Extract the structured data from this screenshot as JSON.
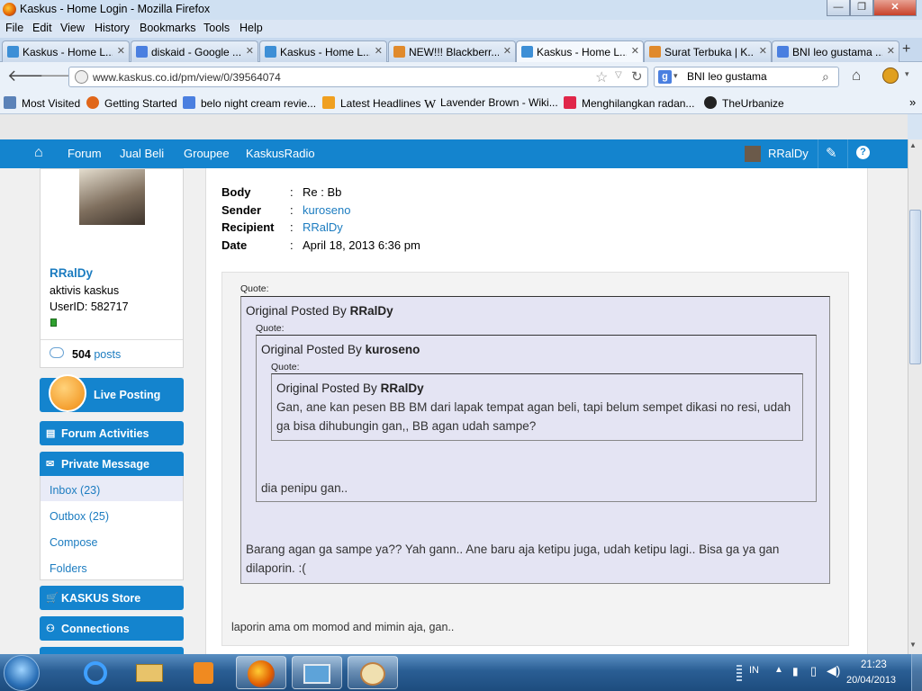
{
  "window": {
    "title": "Kaskus - Home Login - Mozilla Firefox",
    "min": "—",
    "max": "❐",
    "close": "✕"
  },
  "menu": [
    "File",
    "Edit",
    "View",
    "History",
    "Bookmarks",
    "Tools",
    "Help"
  ],
  "tabs": [
    {
      "label": "Kaskus - Home L...",
      "icon_color": "#3d8fd6"
    },
    {
      "label": "diskaid - Google ...",
      "icon_color": "#4a7fe0"
    },
    {
      "label": "Kaskus - Home L...",
      "icon_color": "#3d8fd6"
    },
    {
      "label": "NEW!!! Blackberr...",
      "icon_color": "#e08a2c"
    },
    {
      "label": "Kaskus - Home L...",
      "icon_color": "#3d8fd6"
    },
    {
      "label": "Surat Terbuka | K...",
      "icon_color": "#e08a2c"
    },
    {
      "label": "BNI leo gustama ...",
      "icon_color": "#4a7fe0"
    }
  ],
  "nav": {
    "url": "www.kaskus.co.id/pm/view/0/39564074",
    "search_value": "BNI leo gustama"
  },
  "bookmarks": [
    {
      "label": "Most Visited",
      "icon_color": "#5b82b8"
    },
    {
      "label": "Getting Started",
      "icon_color": "#e0661a"
    },
    {
      "label": "belo night cream revie...",
      "icon_color": "#4a7fe0"
    },
    {
      "label": "Latest Headlines",
      "icon_color": "#f0a020"
    },
    {
      "label": "Lavender Brown - Wiki...",
      "icon_color": "#ffffff"
    },
    {
      "label": "Menghilangkan radan...",
      "icon_color": "#e0264a"
    },
    {
      "label": "TheUrbanize",
      "icon_color": "#222222"
    }
  ],
  "bookmarks_more": "»",
  "kaskus_nav": {
    "items": [
      "Forum",
      "Jual Beli",
      "Groupee",
      "KaskusRadio"
    ],
    "user": "RRalDy",
    "help": "?"
  },
  "profile": {
    "name": "RRalDy",
    "rank": "aktivis kaskus",
    "userid": "UserID: 582717",
    "posts_count": "504",
    "posts_label": "posts"
  },
  "sidebar": {
    "live_posting": "Live Posting",
    "forum_activities": "Forum Activities",
    "private_message": "Private Message",
    "pm_links": [
      "Inbox (23)",
      "Outbox (25)",
      "Compose",
      "Folders"
    ],
    "store": "KASKUS Store",
    "connections": "Connections"
  },
  "message": {
    "labels": [
      "Body",
      "Sender",
      "Recipient",
      "Date"
    ],
    "colon": ":",
    "body": "Re : Bb",
    "sender": "kuroseno",
    "recipient": "RRalDy",
    "date": "April 18, 2013 6:36 pm"
  },
  "quote": {
    "label": "Quote:",
    "posted_by": "Original Posted By",
    "outer_author": "RRalDy",
    "mid_author": "kuroseno",
    "inner_author": "RRalDy",
    "inner_text": "Gan, ane kan pesen BB BM dari lapak tempat agan beli, tapi belum sempet dikasi no resi, udah ga bisa dihubungin gan,, BB agan udah sampe?",
    "mid_text": "dia penipu gan..",
    "outer_text": "Barang agan ga sampe ya?? Yah gann.. Ane baru aja ketipu juga, udah ketipu lagi.. Bisa ga ya gan dilaporin. :("
  },
  "reply": "laporin ama om momod and mimin aja, gan..",
  "taskbar": {
    "lang": "IN",
    "time": "21:23",
    "date": "20/04/2013"
  }
}
